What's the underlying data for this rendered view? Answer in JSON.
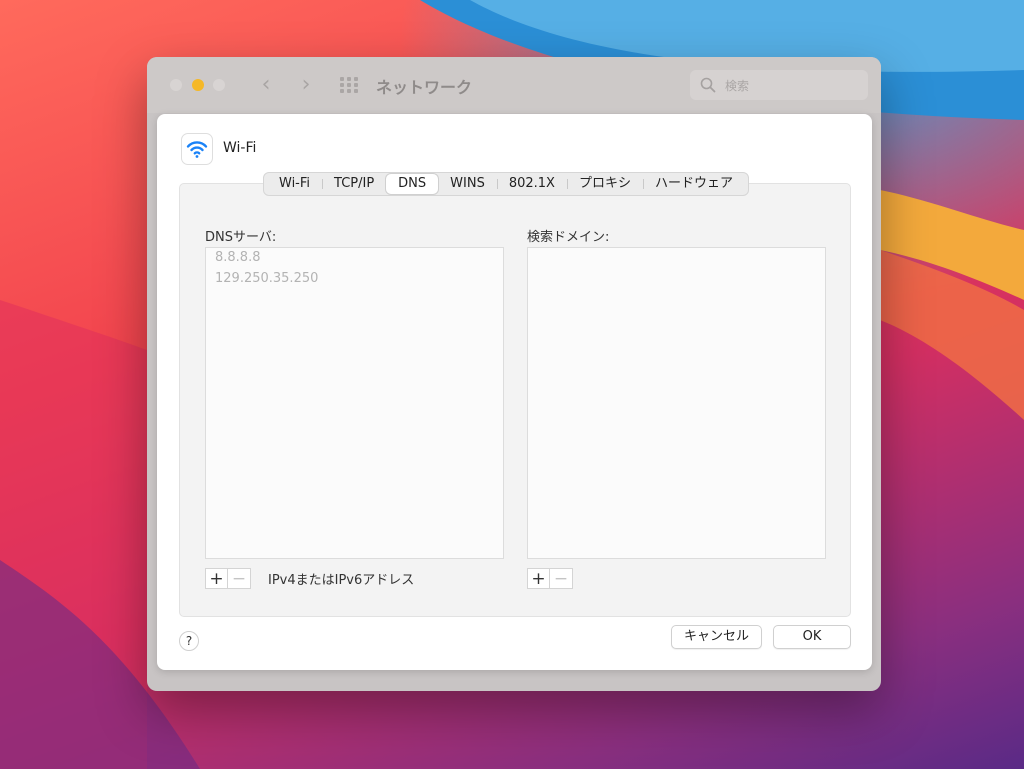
{
  "window": {
    "title": "ネットワーク",
    "search_placeholder": "検索",
    "nav_back": "‹",
    "nav_forward": "›"
  },
  "interface": {
    "name": "Wi-Fi",
    "icon": "wifi-icon",
    "accent": "#1a82f7"
  },
  "tabs": [
    {
      "label": "Wi-Fi",
      "active": false
    },
    {
      "label": "TCP/IP",
      "active": false
    },
    {
      "label": "DNS",
      "active": true
    },
    {
      "label": "WINS",
      "active": false
    },
    {
      "label": "802.1X",
      "active": false
    },
    {
      "label": "プロキシ",
      "active": false
    },
    {
      "label": "ハードウェア",
      "active": false
    }
  ],
  "dns": {
    "label": "DNSサーバ:",
    "servers": [
      "8.8.8.8",
      "129.250.35.250"
    ],
    "hint": "IPv4またはIPv6アドレス",
    "add": "+",
    "remove": "−"
  },
  "search_domains": {
    "label": "検索ドメイン:",
    "entries": [],
    "add": "+",
    "remove": "−"
  },
  "footer": {
    "help": "?",
    "cancel": "キャンセル",
    "ok": "OK"
  }
}
